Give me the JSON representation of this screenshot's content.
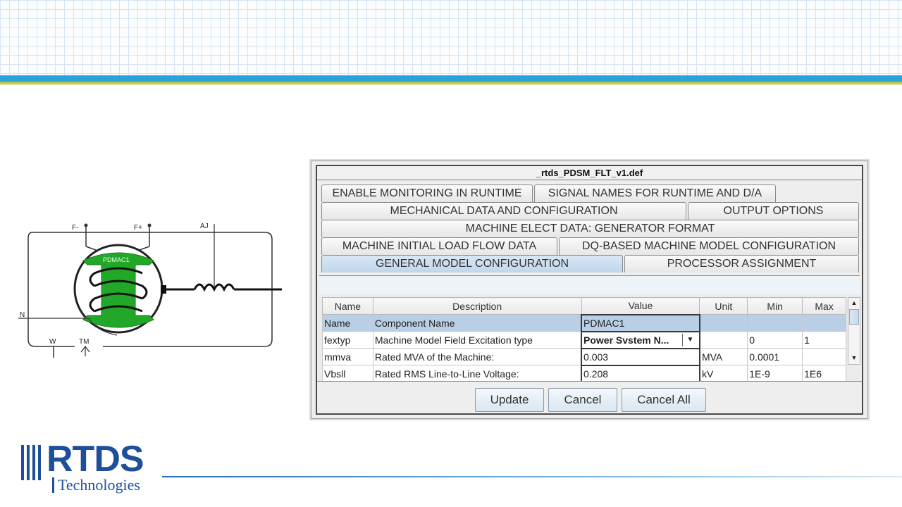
{
  "dialog": {
    "title": "_rtds_PDSM_FLT_v1.def",
    "tabs": [
      {
        "label": "ENABLE MONITORING IN RUNTIME"
      },
      {
        "label": "SIGNAL NAMES FOR RUNTIME AND D/A"
      },
      {
        "label": "MECHANICAL DATA AND CONFIGURATION"
      },
      {
        "label": "OUTPUT OPTIONS"
      },
      {
        "label": "MACHINE ELECT DATA:  GENERATOR FORMAT"
      },
      {
        "label": "MACHINE INITIAL LOAD FLOW DATA"
      },
      {
        "label": "DQ-BASED MACHINE MODEL CONFIGURATION"
      },
      {
        "label": "GENERAL MODEL CONFIGURATION"
      },
      {
        "label": "PROCESSOR ASSIGNMENT"
      }
    ],
    "active_tab": "GENERAL MODEL CONFIGURATION",
    "table": {
      "headers": [
        "Name",
        "Description",
        "Value",
        "Unit",
        "Min",
        "Max"
      ],
      "rows": [
        {
          "name": "Name",
          "description": "Component Name",
          "value": "PDMAC1",
          "unit": "",
          "min": "",
          "max": ""
        },
        {
          "name": "fextyp",
          "description": "Machine Model Field Excitation type",
          "value": "Power Svstem N...",
          "unit": "",
          "min": "0",
          "max": "1"
        },
        {
          "name": "mmva",
          "description": "Rated MVA of the Machine:",
          "value": "0.003",
          "unit": "MVA",
          "min": "0.0001",
          "max": ""
        },
        {
          "name": "Vbsll",
          "description": "Rated RMS Line-to-Line Voltage:",
          "value": "0.208",
          "unit": "kV",
          "min": "1E-9",
          "max": "1E6"
        }
      ]
    },
    "buttons": {
      "update": "Update",
      "cancel": "Cancel",
      "cancel_all": "Cancel All"
    }
  },
  "diagram": {
    "labels": {
      "f_minus": "F-",
      "f_plus": "F+",
      "aj": "AJ",
      "component": "PDMAC1",
      "n": "N",
      "w": "W",
      "tm": "TM"
    },
    "rotor_color": "#22a828"
  },
  "logo": {
    "main": "RTDS",
    "sub": "Technologies",
    "color": "#1d4f9c"
  },
  "colors": {
    "band_blue": "#2aa3dc",
    "band_gold": "#c4c94a",
    "selection": "#b8cfe6"
  }
}
